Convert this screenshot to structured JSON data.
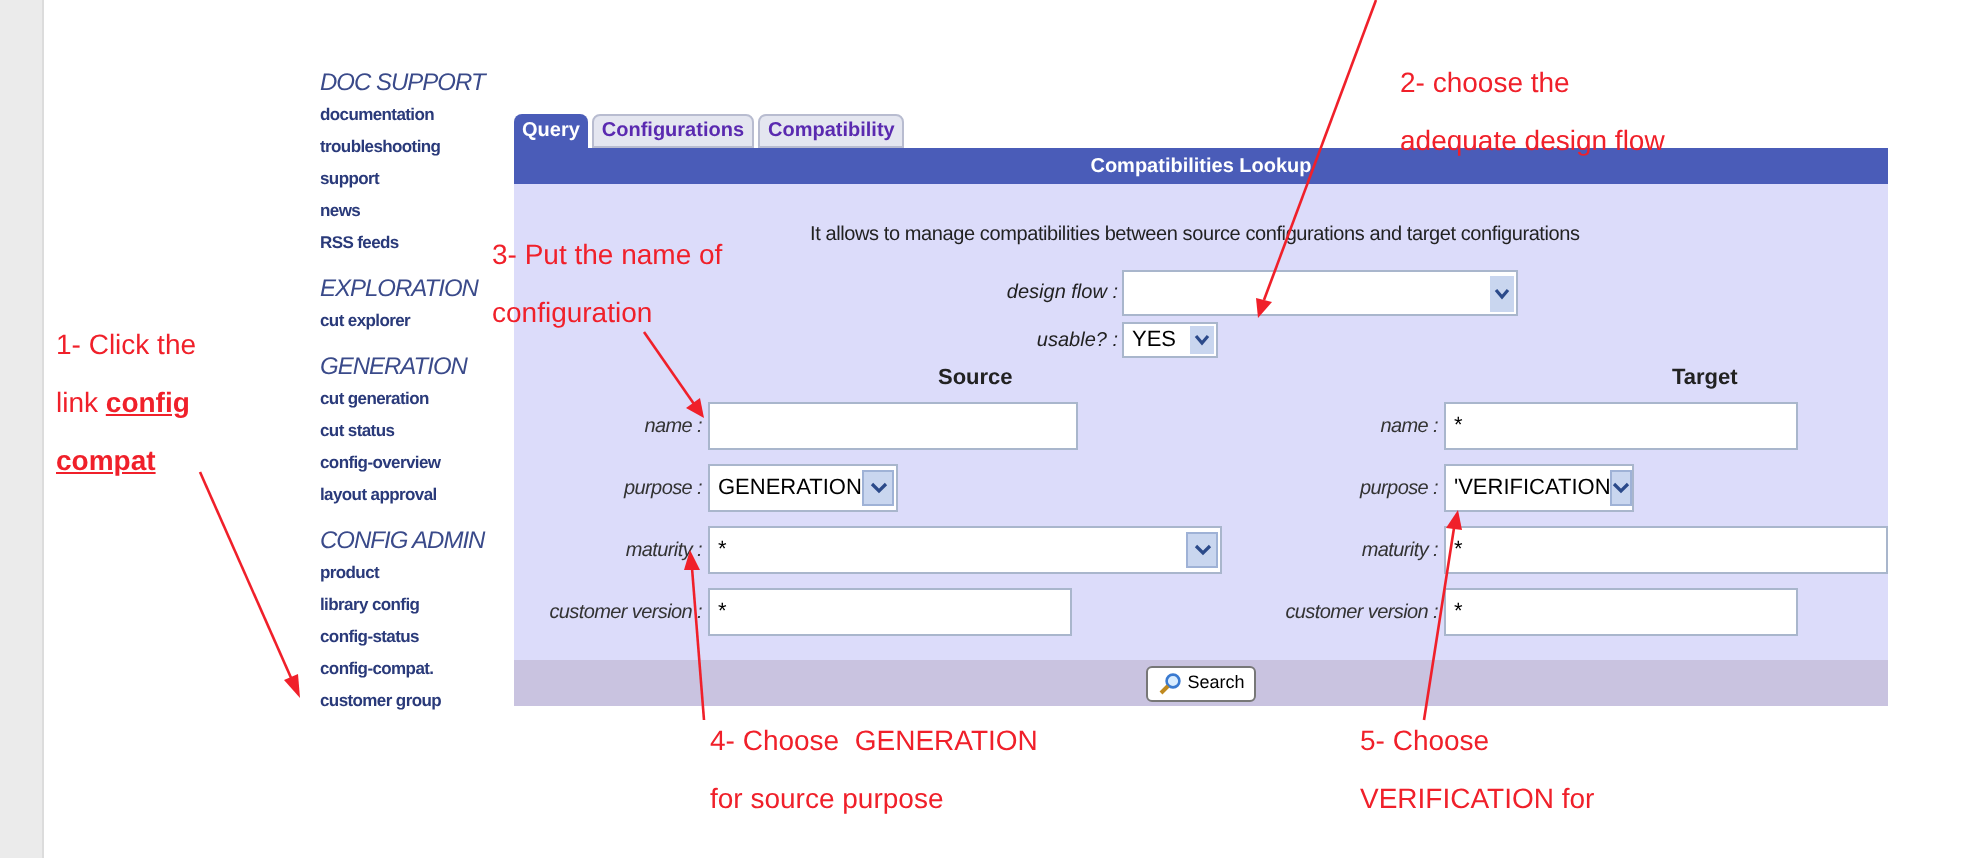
{
  "sidebar": {
    "sections": [
      {
        "heading": "DOC SUPPORT",
        "items": [
          "documentation",
          "troubleshooting",
          "support",
          "news",
          "RSS feeds"
        ]
      },
      {
        "heading": "EXPLORATION",
        "items": [
          "cut explorer"
        ]
      },
      {
        "heading": "GENERATION",
        "items": [
          "cut generation",
          "cut status",
          "config-overview",
          "layout approval"
        ]
      },
      {
        "heading": "CONFIG ADMIN",
        "items": [
          "product",
          "library config",
          "config-status",
          "config-compat.",
          "customer group"
        ]
      }
    ]
  },
  "tabs": [
    {
      "label": "Query",
      "selected": true
    },
    {
      "label": "Configurations",
      "selected": false
    },
    {
      "label": "Compatibility",
      "selected": false
    }
  ],
  "panel": {
    "title": "Compatibilities Lookup",
    "description": "It allows to manage compatibilities between source configurations and target configurations",
    "design_flow": {
      "label": "design flow :"
    },
    "usable": {
      "label": "usable? :",
      "value": "YES"
    },
    "columns": [
      {
        "heading": "Source",
        "fields": [
          {
            "label": "name :",
            "kind": "text"
          },
          {
            "label": "purpose :",
            "kind": "select",
            "value": "GENERATION"
          },
          {
            "label": "maturity :",
            "kind": "select",
            "value": "*"
          },
          {
            "label": "customer version :",
            "kind": "text",
            "value": "*"
          }
        ]
      },
      {
        "heading": "Target",
        "fields": [
          {
            "label": "name :",
            "kind": "text",
            "value": "*"
          },
          {
            "label": "purpose :",
            "kind": "select",
            "value": "'VERIFICATION"
          },
          {
            "label": "maturity :",
            "kind": "text",
            "value": "*"
          },
          {
            "label": "customer version :",
            "kind": "text",
            "value": "*"
          }
        ]
      }
    ],
    "search_button": "Search"
  },
  "annotations": [
    {
      "lines": [
        "1- Click the",
        "link **config**",
        "**compat**"
      ]
    },
    {
      "lines": [
        "2- choose the",
        "adequate design flow"
      ]
    },
    {
      "lines": [
        "3- Put the name of",
        "configuration"
      ]
    },
    {
      "lines": [
        "4- Choose  GENERATION",
        "for source purpose"
      ]
    },
    {
      "lines": [
        "5- Choose",
        "VERIFICATION for"
      ]
    }
  ]
}
